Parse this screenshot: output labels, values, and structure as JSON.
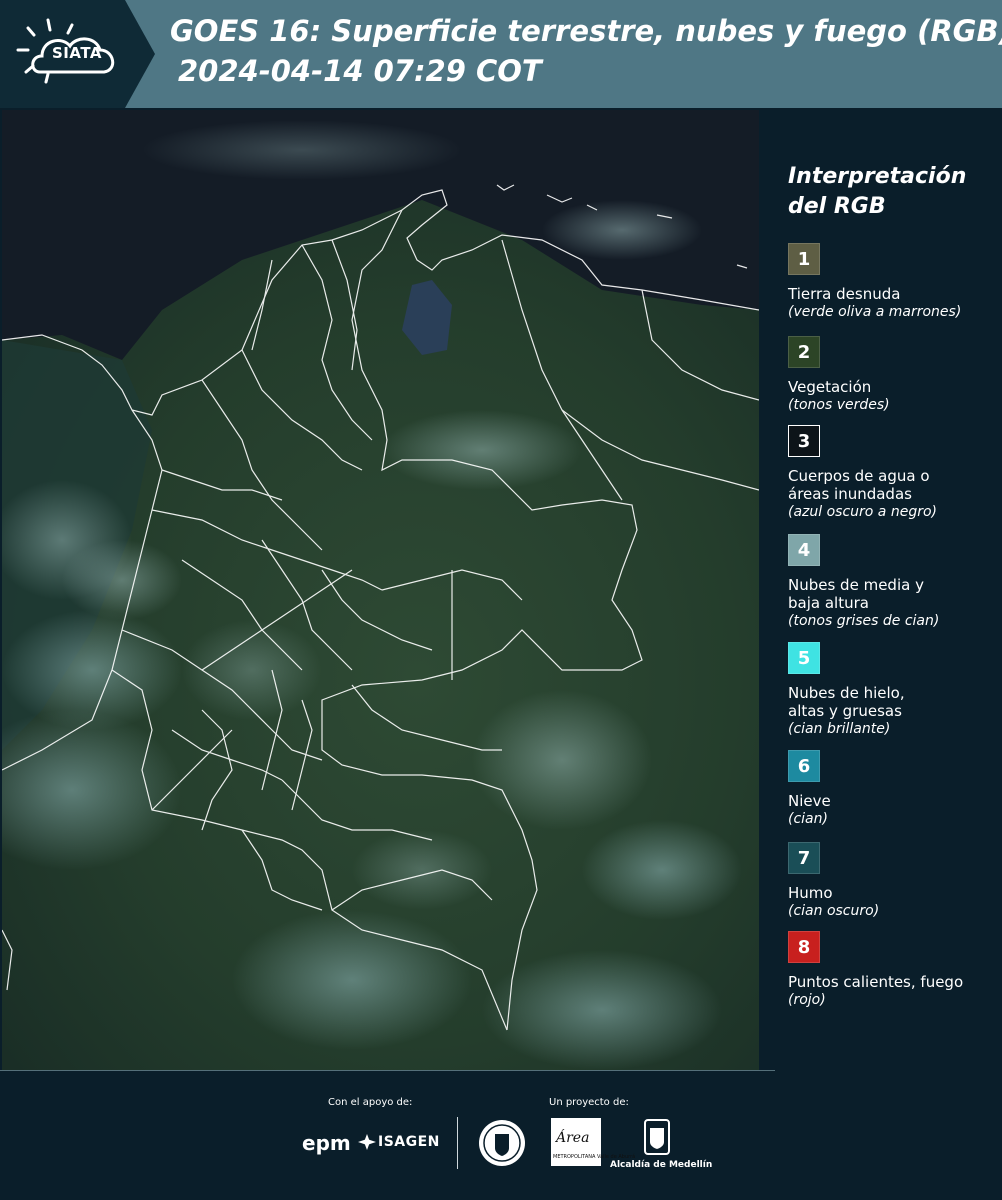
{
  "header": {
    "logo_text": "SIATA",
    "title_line1": "GOES 16: Superficie terrestre, nubes y fuego (RGB)",
    "title_line2": "2024-04-14 07:29 COT"
  },
  "legend": {
    "title": "Interpretación del RGB",
    "items": [
      {
        "number": "1",
        "label": "Tierra desnuda",
        "desc": "(verde oliva a marrones)",
        "color": "#5e5e44"
      },
      {
        "number": "2",
        "label": "Vegetación",
        "desc": "(tonos verdes)",
        "color": "#2c4426"
      },
      {
        "number": "3",
        "label": "Cuerpos de agua o\náreas inundadas",
        "desc": "(azul oscuro a negro)",
        "color": "#0d1419"
      },
      {
        "number": "4",
        "label": "Nubes de media y\nbaja altura",
        "desc": "(tonos grises de cian)",
        "color": "#7fa6a9"
      },
      {
        "number": "5",
        "label": "Nubes de hielo,\naltas y gruesas",
        "desc": "(cian brillante)",
        "color": "#3fe3e3"
      },
      {
        "number": "6",
        "label": "Nieve",
        "desc": "(cian)",
        "color": "#1d8aa0"
      },
      {
        "number": "7",
        "label": "Humo",
        "desc": "(cian oscuro)",
        "color": "#1a4e57"
      },
      {
        "number": "8",
        "label": "Puntos calientes, fuego",
        "desc": "(rojo)",
        "color": "#c8201e"
      }
    ]
  },
  "footer": {
    "support_label": "Con el apoyo de:",
    "project_label": "Un proyecto de:",
    "epm": "epm",
    "isagen": "ISAGEN",
    "area_logo": "Área",
    "area_sub": "METROPOLITANA Valle de Aburrá",
    "alcaldia": "Alcaldía de Medellín"
  },
  "colors": {
    "header_bg": "#4f7785",
    "page_bg": "#0a1e2a",
    "map_border": "#ffffff"
  }
}
